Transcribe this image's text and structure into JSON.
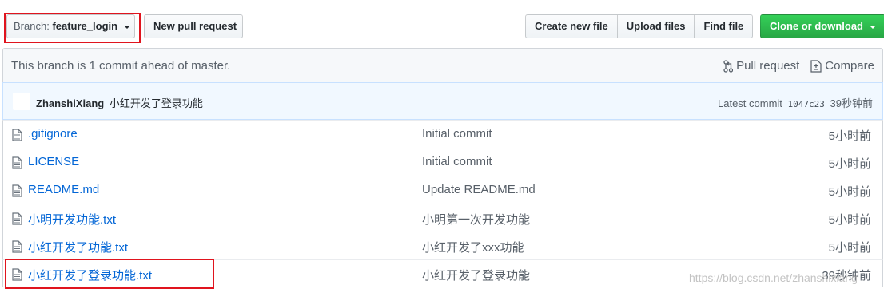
{
  "toolbar": {
    "branch_prefix": "Branch:",
    "branch_name": "feature_login",
    "new_pr_label": "New pull request",
    "create_file_label": "Create new file",
    "upload_files_label": "Upload files",
    "find_file_label": "Find file",
    "clone_label": "Clone or download"
  },
  "ahead_bar": {
    "message": "This branch is 1 commit ahead of master.",
    "pull_request_label": "Pull request",
    "compare_label": "Compare"
  },
  "commit": {
    "author": "ZhanshiXiang",
    "message": "小红开发了登录功能",
    "latest_label": "Latest commit",
    "sha": "1047c23",
    "age": "39秒钟前"
  },
  "files": [
    {
      "name": ".gitignore",
      "message": "Initial commit",
      "age": "5小时前"
    },
    {
      "name": "LICENSE",
      "message": "Initial commit",
      "age": "5小时前"
    },
    {
      "name": "README.md",
      "message": "Update README.md",
      "age": "5小时前"
    },
    {
      "name": "小明开发功能.txt",
      "message": "小明第一次开发功能",
      "age": "5小时前"
    },
    {
      "name": "小红开发了功能.txt",
      "message": "小红开发了xxx功能",
      "age": "5小时前"
    },
    {
      "name": "小红开发了登录功能.txt",
      "message": "小红开发了登录功能",
      "age": "39秒钟前"
    }
  ],
  "watermark": "https://blog.csdn.net/zhanshixiang",
  "colors": {
    "link": "#0366d6",
    "clone_button": "#28a745",
    "annotation_box": "#e0141e"
  }
}
